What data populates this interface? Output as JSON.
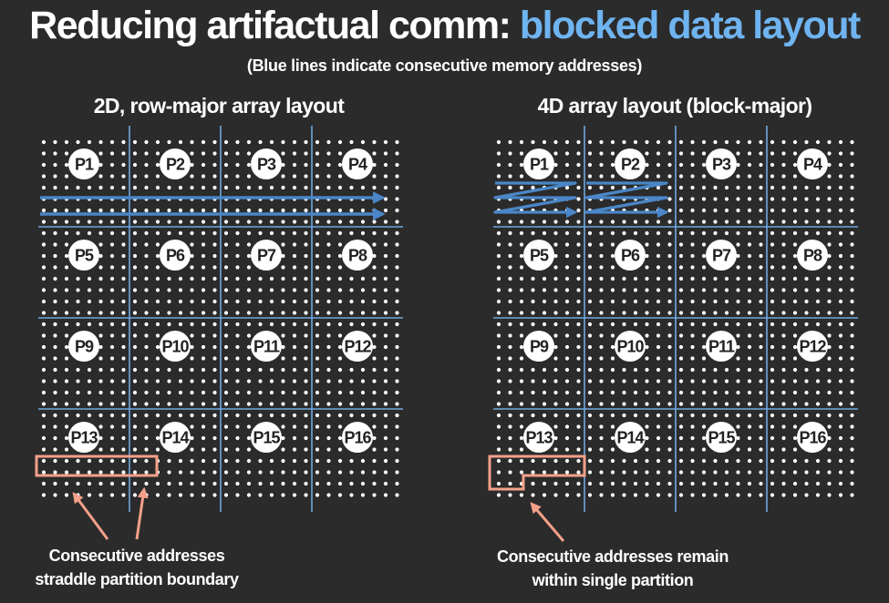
{
  "title": {
    "prefix": "Reducing artifactual comm: ",
    "highlight": "blocked data layout",
    "highlight_color": "#6fb4f0"
  },
  "subtitle": "(Blue lines indicate consecutive memory addresses)",
  "left_panel": {
    "title": "2D, row-major array layout",
    "caption_line1": "Consecutive addresses",
    "caption_line2": "straddle partition boundary"
  },
  "right_panel": {
    "title": "4D array layout (block-major)",
    "caption_line1": "Consecutive addresses remain",
    "caption_line2": "within single partition"
  },
  "partitions": [
    "P1",
    "P2",
    "P3",
    "P4",
    "P5",
    "P6",
    "P7",
    "P8",
    "P9",
    "P10",
    "P11",
    "P12",
    "P13",
    "P14",
    "P15",
    "P16"
  ],
  "colors": {
    "background": "#2b2b2b",
    "grid_line": "#6fa8e0",
    "arrow": "#4a86c8",
    "highlight_box": "#f4a08a",
    "dot": "#ffffff"
  }
}
